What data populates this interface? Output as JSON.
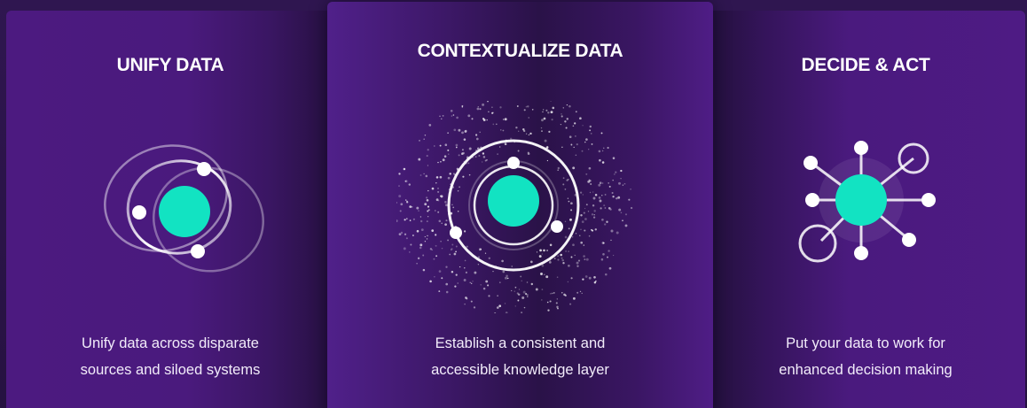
{
  "cards": [
    {
      "title": "UNIFY DATA",
      "description_lines": [
        "Unify data across disparate",
        "sources and siloed systems"
      ]
    },
    {
      "title": "CONTEXTUALIZE DATA",
      "description_lines": [
        "Establish a consistent and",
        "accessible knowledge layer"
      ]
    },
    {
      "title": "DECIDE & ACT",
      "description_lines": [
        "Put your data to work for",
        "enhanced decision making"
      ]
    }
  ],
  "colors": {
    "accent": "#12e3c2",
    "card_purple": "#4c1a80",
    "background": "#2a1446",
    "text": "#ffffff"
  },
  "icons": [
    "orbit-rings-icon",
    "particle-orbit-icon",
    "network-nodes-icon"
  ]
}
